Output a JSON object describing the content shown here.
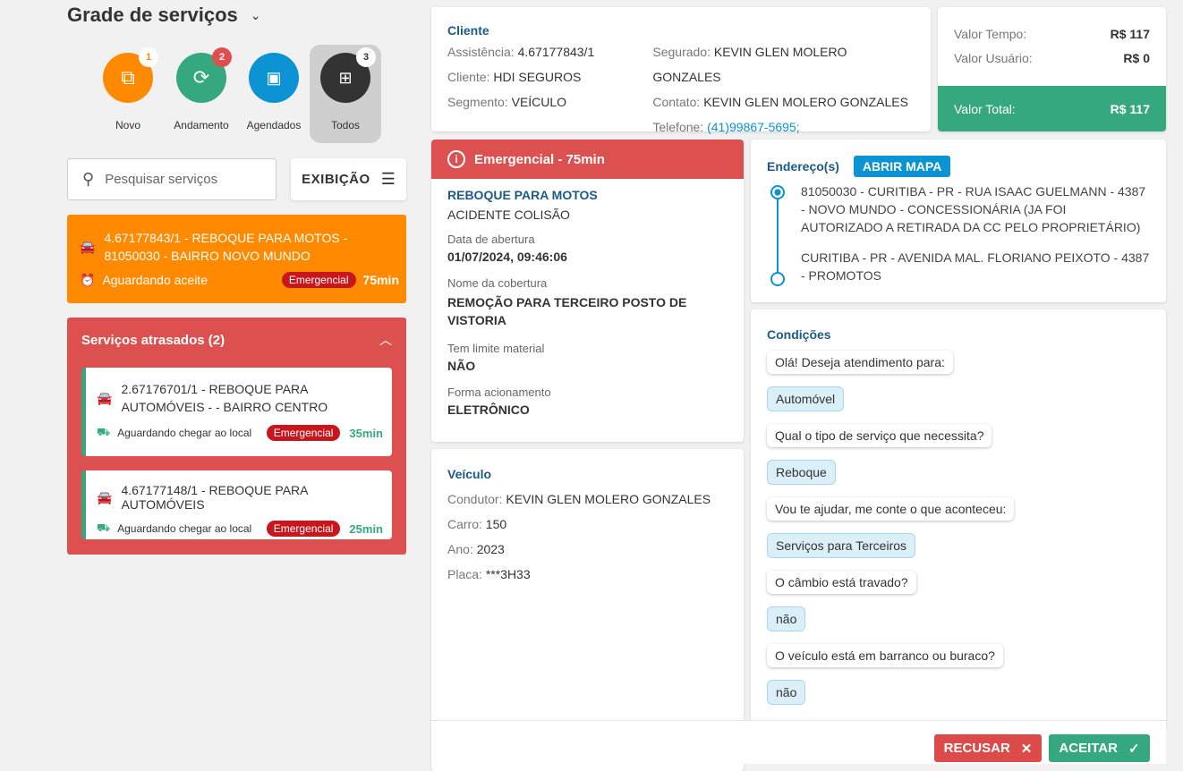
{
  "sidebar": {
    "title": "Grade de serviços",
    "categories": [
      {
        "label": "Novo",
        "count": "1",
        "color": "#ff8a00"
      },
      {
        "label": "Andamento",
        "count": "2",
        "color": "#35a87f"
      },
      {
        "label": "Agendados",
        "count": "",
        "color": "#0b93d3"
      },
      {
        "label": "Todos",
        "count": "3",
        "color": "#333333"
      }
    ],
    "search_placeholder": "Pesquisar serviços",
    "display_button": "EXIBIÇÃO",
    "active_service": {
      "title": "4.67177843/1 - REBOQUE PARA MOTOS - 81050030 - BAIRRO NOVO MUNDO",
      "status": "Aguardando aceite",
      "badge": "Emergencial",
      "time": "75min"
    },
    "late": {
      "title": "Serviços atrasados (2)",
      "items": [
        {
          "title": "2.67176701/1 - REBOQUE PARA AUTOMÓVEIS - - BAIRRO CENTRO",
          "status": "Aguardando chegar ao local",
          "badge": "Emergencial",
          "time": "35min"
        },
        {
          "title": "4.67177148/1 - REBOQUE PARA AUTOMÓVEIS",
          "status": "Aguardando chegar ao local",
          "badge": "Emergencial",
          "time": "25min"
        }
      ]
    }
  },
  "client": {
    "title": "Cliente",
    "assistencia_label": "Assistência:",
    "assistencia": "4.67177843/1",
    "cliente_label": "Cliente:",
    "cliente": "HDI SEGUROS",
    "segmento_label": "Segmento:",
    "segmento": "VEÍCULO",
    "segurado_label": "Segurado:",
    "segurado": "KEVIN GLEN MOLERO GONZALES",
    "contato_label": "Contato:",
    "contato": "KEVIN GLEN MOLERO GONZALES",
    "telefone_label": "Telefone:",
    "telefone": "(41)99867-5695;"
  },
  "values": {
    "tempo_label": "Valor Tempo:",
    "tempo": "R$ 117",
    "usuario_label": "Valor Usuário:",
    "usuario": "R$ 0",
    "total_label": "Valor Total:",
    "total": "R$ 117"
  },
  "service": {
    "header": "Emergencial - 75min",
    "type": "REBOQUE PARA MOTOS",
    "cause": "ACIDENTE COLISÃO",
    "fields": [
      {
        "label": "Data de abertura",
        "value": "01/07/2024, 09:46:06"
      },
      {
        "label": "Nome da cobertura",
        "value": "REMOÇÃO PARA TERCEIRO POSTO DE VISTORIA"
      },
      {
        "label": "Tem limite material",
        "value": "NÃO"
      },
      {
        "label": "Forma acionamento",
        "value": "ELETRÔNICO"
      }
    ]
  },
  "vehicle": {
    "title": "Veículo",
    "condutor_label": "Condutor:",
    "condutor": "KEVIN GLEN MOLERO GONZALES",
    "carro_label": "Carro:",
    "carro": "150",
    "ano_label": "Ano:",
    "ano": "2023",
    "placa_label": "Placa:",
    "placa": "***3H33"
  },
  "address": {
    "title": "Endereço(s)",
    "map_button": "ABRIR MAPA",
    "origin": "81050030 - CURITIBA - PR - RUA ISAAC GUELMANN - 4387 - NOVO MUNDO - CONCESSIONÁRIA (JA FOI AUTORIZADO A RETIRADA DA CC PELO PROPRIETÁRIO)",
    "destination": "CURITIBA - PR - AVENIDA MAL. FLORIANO PEIXOTO - 4387 - PROMOTOS"
  },
  "conditions": {
    "title": "Condições",
    "messages": [
      {
        "text": "Olá! Deseja atendimento para:",
        "answer": false
      },
      {
        "text": "Automóvel",
        "answer": true
      },
      {
        "text": "Qual o tipo de serviço que necessita?",
        "answer": false
      },
      {
        "text": "Reboque",
        "answer": true
      },
      {
        "text": "Vou te ajudar, me conte o que aconteceu:",
        "answer": false
      },
      {
        "text": "Serviços para Terceiros",
        "answer": true
      },
      {
        "text": "O câmbio está travado?",
        "answer": false
      },
      {
        "text": "não",
        "answer": true
      },
      {
        "text": "O veículo está em barranco ou buraco?",
        "answer": false
      },
      {
        "text": "não",
        "answer": true
      }
    ]
  },
  "actions": {
    "reject": "RECUSAR",
    "accept": "ACEITAR"
  }
}
